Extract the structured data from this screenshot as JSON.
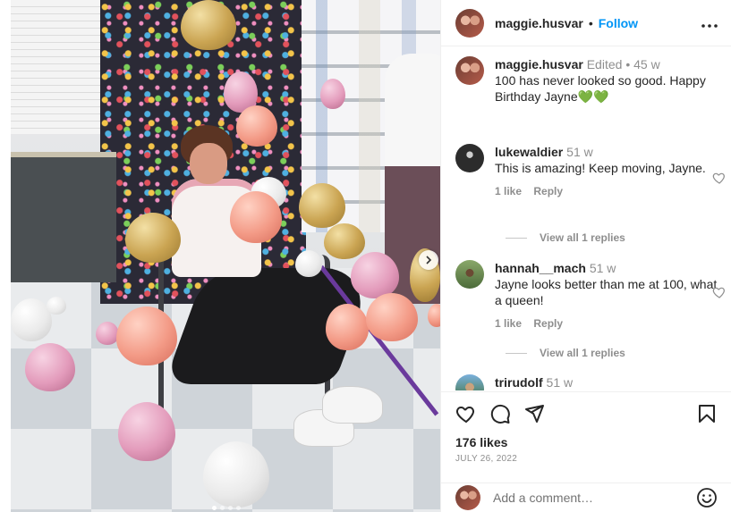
{
  "post": {
    "author": "maggie.husvar",
    "follow_label": "Follow",
    "separator": "•",
    "more_icon": "more-horizontal-icon"
  },
  "caption": {
    "username": "maggie.husvar",
    "edited": "Edited",
    "dot": "•",
    "age": "45 w",
    "text": "100 has never looked so good. Happy Birthday Jayne",
    "emoji": "💚💚"
  },
  "comments": [
    {
      "username": "lukewaldier",
      "age": "51 w",
      "text": "This is amazing! Keep moving, Jayne.",
      "likes": "1 like",
      "reply_label": "Reply",
      "view_replies": "View all 1 replies"
    },
    {
      "username": "hannah__mach",
      "age": "51 w",
      "text": "Jayne looks better than me at 100, what a queen!",
      "likes": "1 like",
      "reply_label": "Reply",
      "view_replies": "View all 1 replies"
    },
    {
      "username": "trirudolf",
      "age": "51 w"
    }
  ],
  "actions": {
    "like_icon": "heart-icon",
    "comment_icon": "comment-icon",
    "share_icon": "share-icon",
    "save_icon": "bookmark-icon",
    "likes_count": "176 likes",
    "date": "JULY 26, 2022"
  },
  "comment_input": {
    "placeholder": "Add a comment…",
    "emoji_icon": "emoji-icon"
  },
  "carousel": {
    "next_icon": "chevron-right-icon",
    "total_slides": 4,
    "current_slide": 1
  },
  "colors": {
    "accent": "#0095f6",
    "muted": "#8e8e8e",
    "heart_emoji": "#2eb82e"
  }
}
